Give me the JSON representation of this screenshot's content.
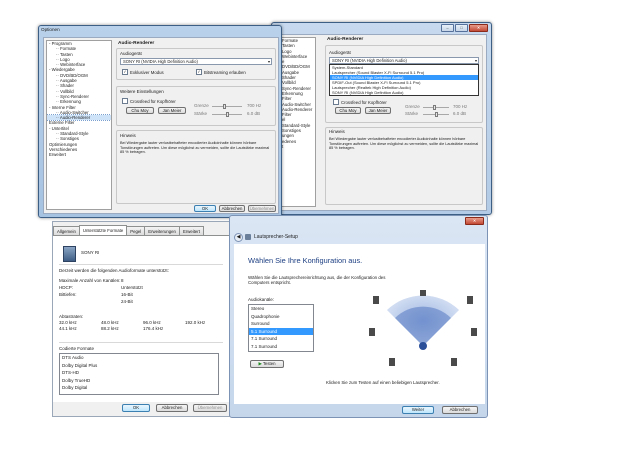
{
  "options_window": {
    "title": "Optionen",
    "tree": [
      {
        "label": "Programm",
        "indent": 0,
        "expander": "-"
      },
      {
        "label": "Formate",
        "indent": 1
      },
      {
        "label": "Tasten",
        "indent": 1
      },
      {
        "label": "Logo",
        "indent": 1
      },
      {
        "label": "Webinterface",
        "indent": 1
      },
      {
        "label": "Wiedergabe",
        "indent": 0,
        "expander": "-"
      },
      {
        "label": "DVD/BD/OGM",
        "indent": 1
      },
      {
        "label": "Ausgabe",
        "indent": 1
      },
      {
        "label": "Shader",
        "indent": 1
      },
      {
        "label": "Vollbild",
        "indent": 1
      },
      {
        "label": "Sync-Renderer",
        "indent": 1
      },
      {
        "label": "Erkennung",
        "indent": 1
      },
      {
        "label": "Interne Filter",
        "indent": 0,
        "expander": "-"
      },
      {
        "label": "Audio-Switcher",
        "indent": 1
      },
      {
        "label": "Audio-Renderer",
        "indent": 1,
        "selected": true
      },
      {
        "label": "Externe Filter",
        "indent": 0
      },
      {
        "label": "Untertitel",
        "indent": 0,
        "expander": "-"
      },
      {
        "label": "Standard-Style",
        "indent": 1
      },
      {
        "label": "Sonstiges",
        "indent": 1
      },
      {
        "label": "Optimierungen",
        "indent": 0
      },
      {
        "label": "Verschiedenes",
        "indent": 0
      },
      {
        "label": "Erweitert",
        "indent": 0
      }
    ],
    "page_header": "Audio-Renderer",
    "device_label": "Audiogerät",
    "device_value": "SONY RI (NVIDIA High Definition Audio)",
    "exclusive_mode": "Exklusiver Modus",
    "bitstream": "Bitstreaming erlauben",
    "further_settings": "Weitere Einstellungen",
    "crossfeed": "Crossfeed für Kopfhörer",
    "btn_chu_moy": "Chu Moy",
    "btn_jan_meier": "Jan Meier",
    "cutoff_label": "Grenze",
    "cutoff_value": "700 Hz",
    "level_label": "Stärke",
    "level_value": "6.0 dB",
    "hint_header": "Hinweis",
    "hint_text": "Bei Wiedergabe lauter verlustbehafteter encodierter Audioinhalte können hörbare Tonstörungen auftreten. Um diese möglichst zu vermeiden, sollte die Lautstärke maximal 85 % betragen.",
    "ok": "OK",
    "cancel": "Abbrechen",
    "apply": "Übernehmen"
  },
  "options_window_2": {
    "tree_visible": [
      "Formate",
      "Tasten",
      "Logo",
      "Webinterface",
      "e",
      "DVD/BD/OGM",
      "Ausgabe",
      "Shader",
      "Vollbild",
      "Sync-Renderer",
      "Erkennung",
      "Filter",
      "Audio-Switcher",
      "Audio-Renderer",
      "Filter",
      "el",
      "Standard-Style",
      "Sonstiges",
      "ungen",
      "edenes",
      "t"
    ],
    "dropdown_items": [
      "System-Standard",
      "Lautsprecher (Sound Blaster X-Fi Surround 5.1 Pro)",
      "SONY RI (NVIDIA High Definition Audio)",
      "SPDIF-Out (Sound Blaster X-Fi Surround 5.1 Pro)",
      "Lautsprecher (Realtek High Definition Audio)",
      "SONY RI (NVIDIA High Definition Audio)"
    ],
    "dropdown_selected_index": 2
  },
  "properties_window": {
    "tabs": [
      "Allgemein",
      "Unterstützte Formate",
      "Pegel",
      "Erweiterungen",
      "Erweitert"
    ],
    "active_tab": 1,
    "device_name": "SONY RI",
    "intro": "Derzeit werden die folgenden Audioformate unterstützt:",
    "rows": [
      {
        "label": "Maximale Anzahl von Kanälen:",
        "value": "8"
      },
      {
        "label": "HDCP:",
        "value": "Unterstützt"
      },
      {
        "label": "Bittiefen:",
        "value": "16-Bit"
      },
      {
        "label": "",
        "value": "24-Bit"
      }
    ],
    "samplerates_label": "Abtastraten:",
    "samplerates": [
      [
        "32.0 kHz",
        "48.0 kHz",
        "96.0 kHz",
        "192.0 kHz"
      ],
      [
        "44.1 kHz",
        "88.2 kHz",
        "176.4 kHz",
        ""
      ]
    ],
    "encoded_label": "Codierte Formate",
    "encoded_formats": [
      "DTS Audio",
      "Dolby Digital Plus",
      "DTS-HD",
      "Dolby TrueHD",
      "Dolby Digital"
    ],
    "ok": "OK",
    "cancel": "Abbrechen",
    "apply": "Übernehmen"
  },
  "speaker_setup": {
    "title": "Lautsprecher-Setup",
    "heading": "Wählen Sie Ihre Konfiguration aus.",
    "description": "Wählen Sie die Lautsprechereinrichtung aus, die der Konfiguration des Computers entspricht.",
    "channels_label": "Audiokanäle:",
    "channels": [
      "Stereo",
      "Quadrophonie",
      "Surround",
      "5.1 Surround",
      "7.1 Surround",
      "7.1 Surround"
    ],
    "channels_selected_index": 3,
    "test_button": "Testen",
    "test_hint": "Klicken Sie zum Testen auf einen beliebigen Lautsprecher.",
    "next_button": "Weiter",
    "cancel_button": "Abbrechen"
  }
}
